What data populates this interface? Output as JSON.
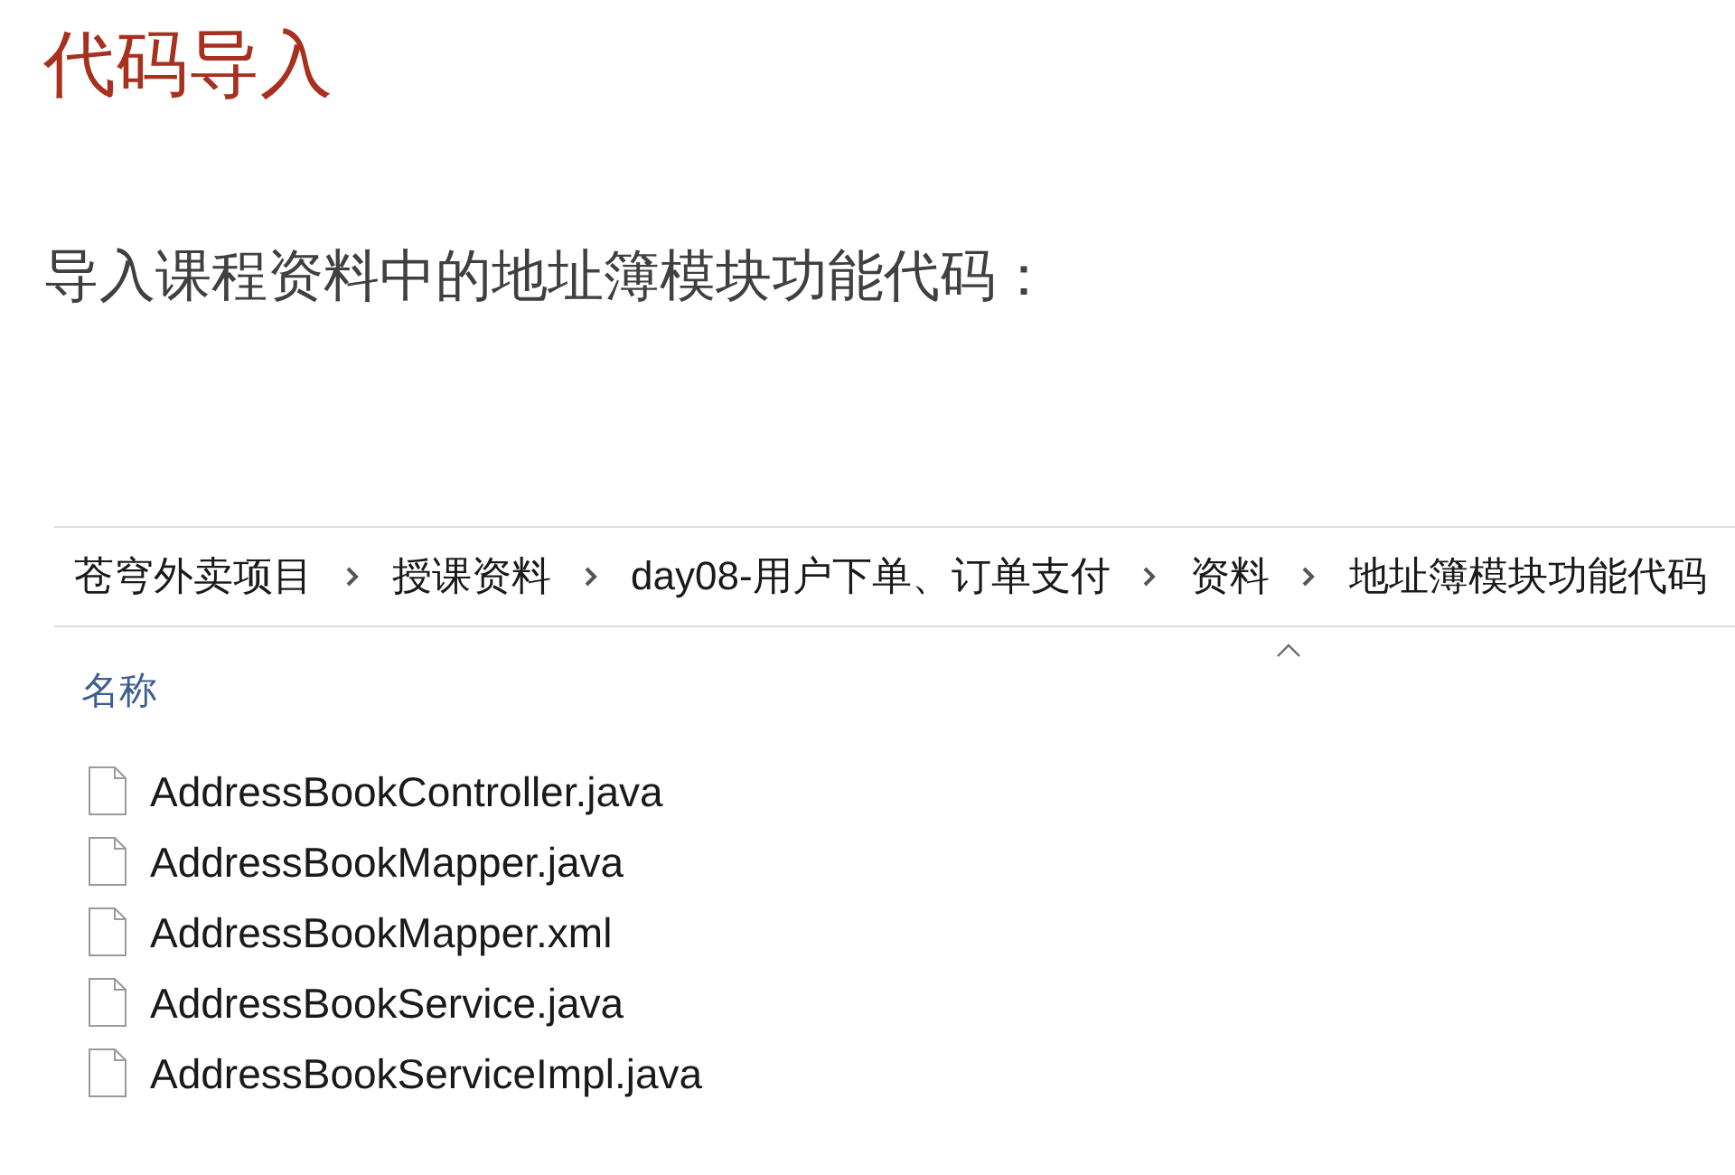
{
  "slide": {
    "title": "代码导入",
    "subtitle": "导入课程资料中的地址簿模块功能代码："
  },
  "explorer": {
    "breadcrumb": [
      {
        "label": "苍穹外卖项目"
      },
      {
        "label": "授课资料"
      },
      {
        "label": "day08-用户下单、订单支付"
      },
      {
        "label": "资料"
      },
      {
        "label": "地址簿模块功能代码"
      }
    ],
    "columns": [
      {
        "label": "名称",
        "sorted": true
      }
    ],
    "files": [
      {
        "name": "AddressBookController.java"
      },
      {
        "name": "AddressBookMapper.java"
      },
      {
        "name": "AddressBookMapper.xml"
      },
      {
        "name": "AddressBookService.java"
      },
      {
        "name": "AddressBookServiceImpl.java"
      }
    ]
  }
}
